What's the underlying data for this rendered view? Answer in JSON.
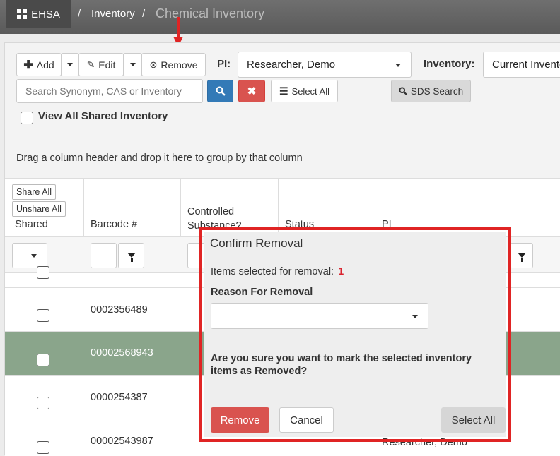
{
  "nav": {
    "brand": "EHSA",
    "breadcrumb": [
      {
        "label": "Inventory"
      },
      {
        "label": "Chemical Inventory"
      }
    ],
    "separator": "/"
  },
  "toolbar": {
    "add_label": "Add",
    "edit_label": "Edit",
    "remove_label": "Remove",
    "pi_label": "PI:",
    "pi_value": "Researcher, Demo",
    "inventory_label": "Inventory:",
    "inventory_value": "Current Inventory",
    "search_placeholder": "Search Synonym, CAS or Inventory",
    "select_all_label": "Select All",
    "sds_search_label": "SDS Search",
    "view_all_shared_label": "View All Shared Inventory"
  },
  "grid": {
    "group_hint": "Drag a column header and drop it here to group by that column",
    "share_all_label": "Share All",
    "unshare_all_label": "Unshare All",
    "columns": [
      {
        "label": "Shared"
      },
      {
        "label": "Barcode #"
      },
      {
        "label": "Controlled Substance?"
      },
      {
        "label": "Status"
      },
      {
        "label": "PI"
      }
    ],
    "rows": [
      {
        "barcode": "0002356489",
        "selected": false
      },
      {
        "barcode": "00002568943",
        "selected": true
      },
      {
        "barcode": "0000254387",
        "selected": false
      },
      {
        "barcode": "00002543987",
        "selected": false,
        "pi": "Researcher, Demo"
      }
    ]
  },
  "modal": {
    "title": "Confirm Removal",
    "items_selected_label": "Items selected for removal:",
    "items_selected_count": "1",
    "reason_label": "Reason For Removal",
    "reason_value": "",
    "confirm_text": "Are you sure you want to mark the selected inventory items as Removed?",
    "remove_label": "Remove",
    "cancel_label": "Cancel",
    "select_all_label": "Select All"
  },
  "colors": {
    "highlight": "#e02424",
    "danger": "#d9534f",
    "primary": "#337ab7",
    "selected_row": "#8aa58b"
  }
}
